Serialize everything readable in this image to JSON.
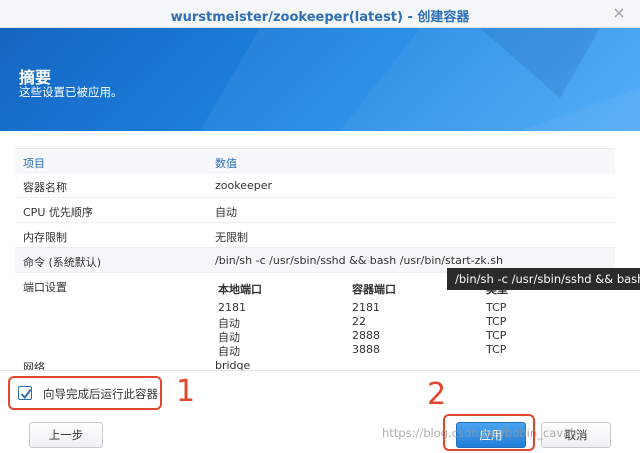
{
  "window": {
    "title": "wurstmeister/zookeeper(latest) - 创建容器",
    "close_glyph": "×"
  },
  "banner": {
    "heading": "摘要",
    "subtitle": "这些设置已被应用。"
  },
  "table": {
    "headers": [
      "项目",
      "数值"
    ],
    "rows": [
      {
        "item": "容器名称",
        "value": "zookeeper"
      },
      {
        "item": "CPU 优先顺序",
        "value": "自动"
      },
      {
        "item": "内存限制",
        "value": "无限制"
      },
      {
        "item": "命令 (系统默认)",
        "value": "/bin/sh -c /usr/sbin/sshd && bash /usr/bin/start-zk.sh"
      }
    ],
    "ports": {
      "item": "端口设置",
      "headers": [
        "本地端口",
        "容器端口",
        "类型"
      ],
      "rows": [
        [
          "2181",
          "2181",
          "TCP"
        ],
        [
          "自动",
          "22",
          "TCP"
        ],
        [
          "自动",
          "2888",
          "TCP"
        ],
        [
          "自动",
          "3888",
          "TCP"
        ]
      ]
    },
    "network": {
      "item": "网络",
      "value": "bridge"
    }
  },
  "tooltip": "/bin/sh -c /usr/sbin/sshd && bash",
  "footer": {
    "checkbox_label": "向导完成后运行此容器",
    "checkbox_checked": true,
    "prev_button": "上一步",
    "apply_button": "应用",
    "cancel_button": "取消"
  },
  "annotations": {
    "one": "1",
    "two": "2"
  },
  "watermark": "https://blog.csdn.net/bobin_cavalry",
  "colors": {
    "accent": "#2d6fb5",
    "annotation": "#e2462c",
    "banner": "#1e88e5"
  }
}
